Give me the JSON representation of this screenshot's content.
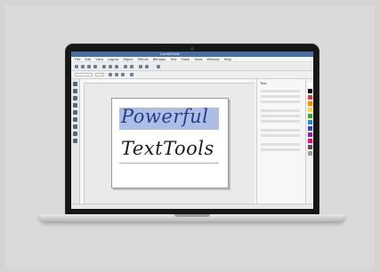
{
  "app": {
    "title": "CorelDRAW",
    "menu": [
      "File",
      "Edit",
      "View",
      "Layout",
      "Object",
      "Effects",
      "Bitmaps",
      "Text",
      "Table",
      "Tools",
      "Window",
      "Help"
    ]
  },
  "canvas": {
    "line1": "Powerful",
    "line2": "TextTools"
  },
  "docker": {
    "title": "Text"
  },
  "status": {
    "text": ""
  },
  "colors": {
    "highlight": "#aebde6",
    "line1": "#223f8a",
    "line2": "#1a1a1a"
  },
  "palette": [
    "#ffffff",
    "#000000",
    "#e53935",
    "#fb8c00",
    "#fdd835",
    "#43a047",
    "#1e88e5",
    "#3949ab",
    "#8e24aa",
    "#d81b60",
    "#6d4c41",
    "#9e9e9e"
  ]
}
